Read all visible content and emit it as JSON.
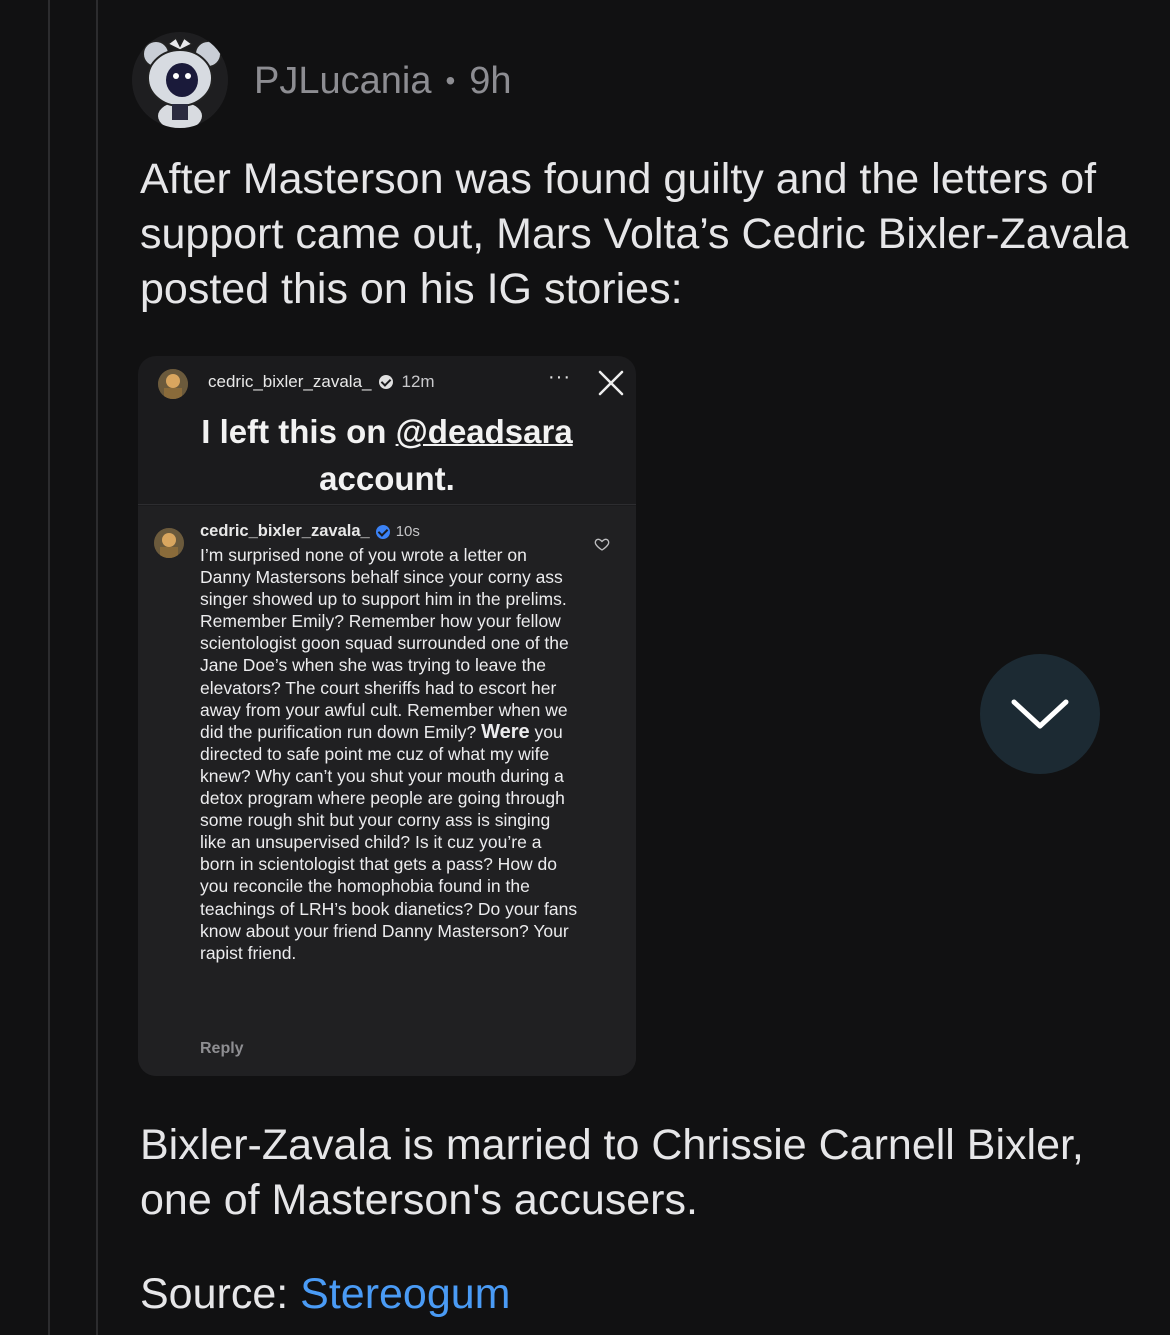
{
  "comment": {
    "author": "PJLucania",
    "separator": "•",
    "age": "9h",
    "body": "After Masterson was found guilty and the letters of support came out, Mars Volta’s Cedric Bixler-Zavala posted this on his IG stories:",
    "footer": "Bixler-Zavala is married to Chrissie Carnell Bixler, one of Masterson's accusers.",
    "source_label": "Source:",
    "source_link": "Stereogum"
  },
  "ig_story": {
    "username": "cedric_bixler_zavala_",
    "time": "12m",
    "more": "···",
    "caption_before": "I left this on ",
    "caption_mention": "@deadsara",
    "caption_after": " account.",
    "reply_comment": {
      "username": "cedric_bixler_zavala_",
      "time": "10s",
      "text_before": "I’m surprised none of you wrote a letter on Danny Mastersons behalf since your corny ass singer showed up to support him in the prelims. Remember Emily? Remember how your fellow scientologist goon squad surrounded one of the Jane Doe’s when she was trying to leave the elevators? The court sheriffs had to escort her away from your awful cult. Remember when we did the purification run down Emily? ",
      "text_emphasis": "Were",
      "text_after": " you directed to safe point me cuz of what my wife knew? Why can’t you shut your mouth during a detox program where people are going through some rough shit but your corny ass is singing like an unsupervised child? Is it cuz you’re a born in scientologist that gets a pass? How do you reconcile the homophobia found in the teachings of LRH’s book dianetics? Do your fans know about your friend Danny Masterson?  Your rapist friend.",
      "reply_label": "Reply"
    }
  },
  "icons": {
    "avatar": "snoo-avatar-icon",
    "close": "close-icon",
    "heart": "heart-icon",
    "verified": "verified-badge-icon",
    "scroll": "chevron-down-icon"
  },
  "colors": {
    "background": "#111112",
    "text": "#e6e6e8",
    "meta": "#8d8d92",
    "link": "#4a9bf5",
    "scroll_button": "#1c2a33",
    "verified": "#3b82f6"
  }
}
